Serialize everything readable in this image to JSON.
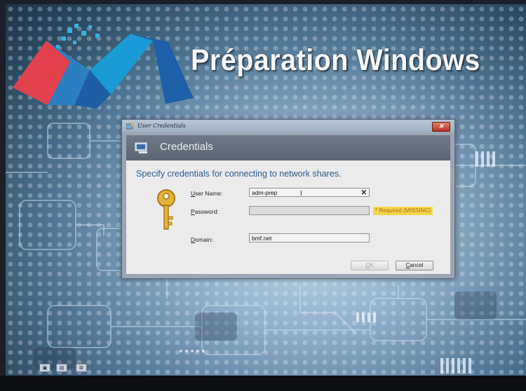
{
  "banner": {
    "title": "Préparation Windows"
  },
  "logo": {
    "name": "deployment-logo"
  },
  "dialog": {
    "window_title": "User Credentials",
    "close_symbol": "✕",
    "header_title": "Credentials",
    "instruction": "Specify credentials for connecting to network shares.",
    "fields": {
      "username": {
        "label_accel": "U",
        "label_rest": "ser Name:",
        "value": "adm-prep",
        "clear_symbol": "✕"
      },
      "password": {
        "label_accel": "P",
        "label_rest": "assword:",
        "value": "",
        "status": "* Required (MISSING)"
      },
      "domain": {
        "label_accel": "D",
        "label_rest": "omain:",
        "value": "bmf.net"
      }
    },
    "buttons": {
      "ok": {
        "accel": "O",
        "rest": "K",
        "enabled": false
      },
      "cancel": {
        "accel": "C",
        "rest": "ancel",
        "enabled": true
      }
    }
  },
  "colors": {
    "title_text": "#f4f6f8",
    "instruction_text": "#2f5d8c",
    "required_bg": "#f3d64a",
    "required_text": "#b5651d",
    "close_button": "#c8452a"
  }
}
